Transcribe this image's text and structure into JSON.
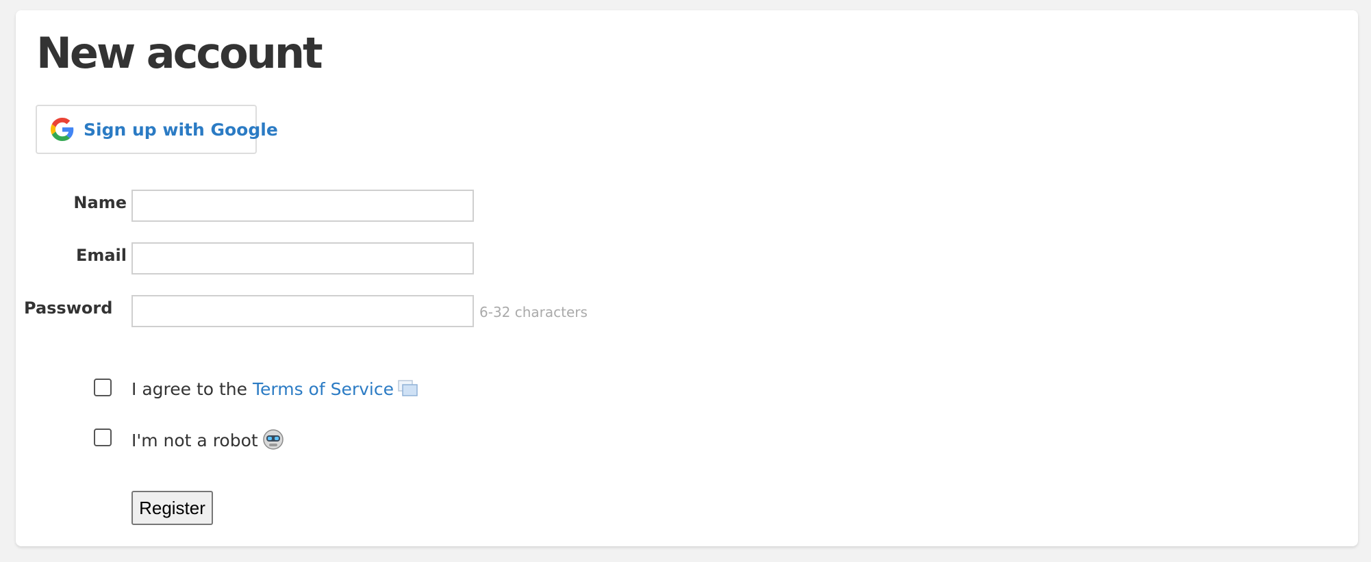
{
  "page": {
    "title": "New account"
  },
  "google": {
    "label": "Sign up with Google",
    "icon": "google-g-icon"
  },
  "form": {
    "name_label": "Name",
    "name_value": "",
    "email_label": "Email",
    "email_value": "",
    "password_label": "Password",
    "password_value": "",
    "password_hint": "6-32 characters"
  },
  "terms": {
    "prefix": "I agree to the ",
    "link": "Terms of Service",
    "icon": "external-link-icon",
    "checked": false
  },
  "robot": {
    "label": "I'm not a robot",
    "icon": "robot-icon",
    "checked": false
  },
  "register": {
    "label": "Register"
  },
  "colors": {
    "link": "#2b7bc4",
    "text": "#333333",
    "hint": "#aaaaaa",
    "background": "#f2f2f2"
  }
}
